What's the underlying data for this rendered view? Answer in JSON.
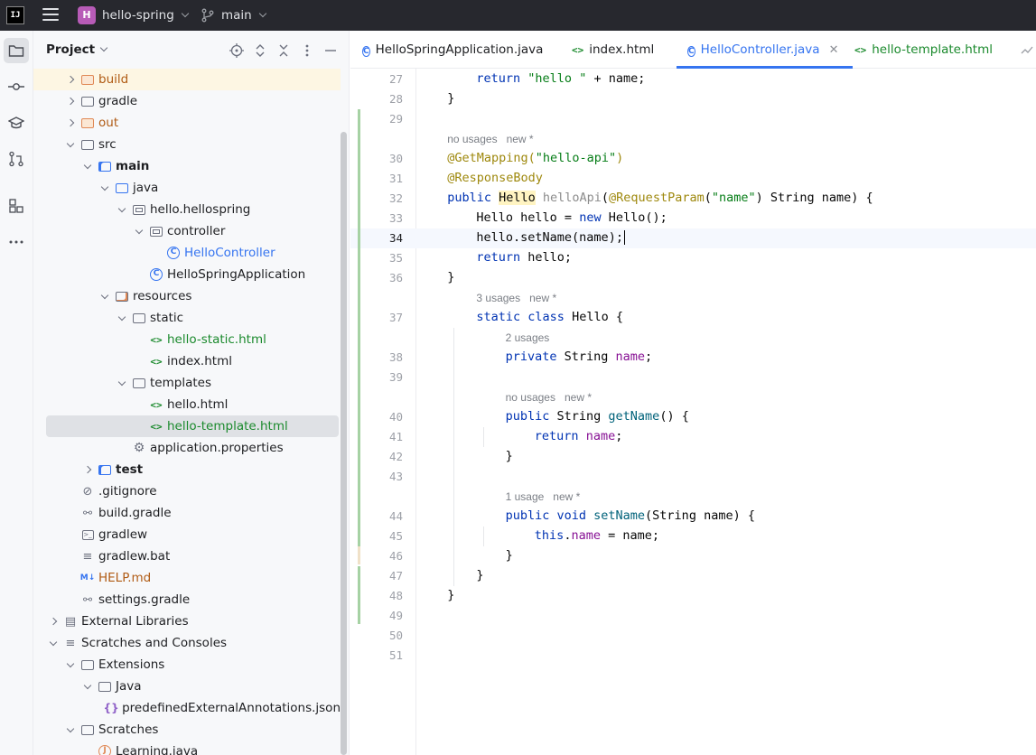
{
  "titlebar": {
    "logo_text": "IJ",
    "project_badge": "H",
    "project_name": "hello-spring",
    "branch": "main"
  },
  "toolstrip": {
    "buttons": [
      "folder-icon",
      "commit-icon",
      "learn-icon",
      "pull-request-icon",
      "structure-icon",
      "more-icon"
    ]
  },
  "project_panel": {
    "title": "Project",
    "tree": [
      {
        "label": "build",
        "depth": 1,
        "arrow": "right",
        "icon": "folder-orange",
        "style": "orange",
        "highlight": true
      },
      {
        "label": "gradle",
        "depth": 1,
        "arrow": "right",
        "icon": "folder"
      },
      {
        "label": "out",
        "depth": 1,
        "arrow": "right",
        "icon": "folder-orange",
        "style": "orange"
      },
      {
        "label": "src",
        "depth": 1,
        "arrow": "down",
        "icon": "folder"
      },
      {
        "label": "main",
        "depth": 2,
        "arrow": "down",
        "icon": "folder-module",
        "style": "bold"
      },
      {
        "label": "java",
        "depth": 3,
        "arrow": "down",
        "icon": "folder-blue"
      },
      {
        "label": "hello.hellospring",
        "depth": 4,
        "arrow": "down",
        "icon": "package"
      },
      {
        "label": "controller",
        "depth": 5,
        "arrow": "down",
        "icon": "package"
      },
      {
        "label": "HelloController",
        "depth": 6,
        "arrow": "none",
        "icon": "java-class",
        "style": "blue"
      },
      {
        "label": "HelloSpringApplication",
        "depth": 5,
        "arrow": "none",
        "icon": "java-class"
      },
      {
        "label": "resources",
        "depth": 3,
        "arrow": "down",
        "icon": "folder-resources"
      },
      {
        "label": "static",
        "depth": 4,
        "arrow": "down",
        "icon": "folder"
      },
      {
        "label": "hello-static.html",
        "depth": 5,
        "arrow": "none",
        "icon": "html",
        "style": "green"
      },
      {
        "label": "index.html",
        "depth": 5,
        "arrow": "none",
        "icon": "html"
      },
      {
        "label": "templates",
        "depth": 4,
        "arrow": "down",
        "icon": "folder"
      },
      {
        "label": "hello.html",
        "depth": 5,
        "arrow": "none",
        "icon": "html"
      },
      {
        "label": "hello-template.html",
        "depth": 5,
        "arrow": "none",
        "icon": "html",
        "style": "green",
        "selected": true
      },
      {
        "label": "application.properties",
        "depth": 4,
        "arrow": "none",
        "icon": "settings"
      },
      {
        "label": "test",
        "depth": 2,
        "arrow": "right",
        "icon": "folder-module",
        "style": "bold"
      },
      {
        "label": ".gitignore",
        "depth": 1,
        "arrow": "none",
        "icon": "ignore"
      },
      {
        "label": "build.gradle",
        "depth": 1,
        "arrow": "none",
        "icon": "gradle"
      },
      {
        "label": "gradlew",
        "depth": 1,
        "arrow": "none",
        "icon": "terminal"
      },
      {
        "label": "gradlew.bat",
        "depth": 1,
        "arrow": "none",
        "icon": "text"
      },
      {
        "label": "HELP.md",
        "depth": 1,
        "arrow": "none",
        "icon": "markdown",
        "style": "orange"
      },
      {
        "label": "settings.gradle",
        "depth": 1,
        "arrow": "none",
        "icon": "gradle"
      },
      {
        "label": "External Libraries",
        "depth": 0,
        "arrow": "right",
        "icon": "library"
      },
      {
        "label": "Scratches and Consoles",
        "depth": 0,
        "arrow": "down",
        "icon": "scratches"
      },
      {
        "label": "Extensions",
        "depth": 1,
        "arrow": "down",
        "icon": "folder"
      },
      {
        "label": "Java",
        "depth": 2,
        "arrow": "down",
        "icon": "folder"
      },
      {
        "label": "predefinedExternalAnnotations.json",
        "depth": 3,
        "arrow": "none",
        "icon": "json"
      },
      {
        "label": "Scratches",
        "depth": 1,
        "arrow": "down",
        "icon": "folder"
      },
      {
        "label": "Learning.java",
        "depth": 2,
        "arrow": "none",
        "icon": "java-scratch"
      }
    ]
  },
  "tabs": [
    {
      "label": "HelloSpringApplication.java",
      "icon": "java-class",
      "active": false
    },
    {
      "label": "index.html",
      "icon": "html",
      "active": false
    },
    {
      "label": "HelloController.java",
      "icon": "java-class",
      "active": true,
      "closable": true
    },
    {
      "label": "hello-template.html",
      "icon": "html",
      "active": false,
      "style": "green"
    }
  ],
  "editor": {
    "current_line": 34,
    "lines": [
      {
        "n": "27",
        "indent": 2,
        "tokens": [
          [
            "kw",
            "return "
          ],
          [
            "str",
            "\"hello \""
          ],
          [
            "",
            " + name;"
          ]
        ]
      },
      {
        "n": "28",
        "indent": 1,
        "tokens": [
          [
            "",
            "}"
          ]
        ]
      },
      {
        "n": "29",
        "indent": 0,
        "tokens": []
      },
      {
        "hint": "no usages   new *",
        "indent": 1
      },
      {
        "n": "30",
        "indent": 1,
        "tokens": [
          [
            "ann",
            "@GetMapping("
          ],
          [
            "str",
            "\"hello-api\""
          ],
          [
            "ann",
            ")"
          ]
        ]
      },
      {
        "n": "31",
        "indent": 1,
        "tokens": [
          [
            "ann",
            "@ResponseBody"
          ]
        ]
      },
      {
        "n": "32",
        "indent": 1,
        "tokens": [
          [
            "kw",
            "public "
          ],
          [
            "hlcls",
            "Hello"
          ],
          [
            "",
            " "
          ],
          [
            "unused",
            "helloApi"
          ],
          [
            "",
            "("
          ],
          [
            "ann",
            "@RequestParam"
          ],
          [
            "",
            "("
          ],
          [
            "str",
            "\"name\""
          ],
          [
            "",
            ") String name) {"
          ]
        ]
      },
      {
        "n": "33",
        "indent": 2,
        "tokens": [
          [
            "",
            "Hello hello = "
          ],
          [
            "kw",
            "new "
          ],
          [
            "",
            "Hello();"
          ]
        ]
      },
      {
        "n": "34",
        "indent": 2,
        "tokens": [
          [
            "",
            "hello.setName(name);"
          ]
        ],
        "caret": true
      },
      {
        "n": "35",
        "indent": 2,
        "tokens": [
          [
            "kw",
            "return "
          ],
          [
            "",
            "hello;"
          ]
        ]
      },
      {
        "n": "36",
        "indent": 1,
        "tokens": [
          [
            "",
            "}"
          ]
        ]
      },
      {
        "hint": "3 usages   new *",
        "indent": 2
      },
      {
        "n": "37",
        "indent": 2,
        "tokens": [
          [
            "kw",
            "static class "
          ],
          [
            "",
            "Hello {"
          ]
        ]
      },
      {
        "hint": "2 usages",
        "indent": 3
      },
      {
        "n": "38",
        "indent": 3,
        "tokens": [
          [
            "kw",
            "private "
          ],
          [
            "",
            "String "
          ],
          [
            "fld",
            "name"
          ],
          [
            "",
            ";"
          ]
        ]
      },
      {
        "n": "39",
        "indent": 0,
        "tokens": []
      },
      {
        "hint": "no usages   new *",
        "indent": 3
      },
      {
        "n": "40",
        "indent": 3,
        "tokens": [
          [
            "kw",
            "public "
          ],
          [
            "",
            "String "
          ],
          [
            "fn",
            "getName"
          ],
          [
            "",
            "() {"
          ]
        ]
      },
      {
        "n": "41",
        "indent": 4,
        "tokens": [
          [
            "kw",
            "return "
          ],
          [
            "fld",
            "name"
          ],
          [
            "",
            ";"
          ]
        ]
      },
      {
        "n": "42",
        "indent": 3,
        "tokens": [
          [
            "",
            "}"
          ]
        ]
      },
      {
        "n": "43",
        "indent": 0,
        "tokens": []
      },
      {
        "hint": "1 usage   new *",
        "indent": 3
      },
      {
        "n": "44",
        "indent": 3,
        "tokens": [
          [
            "kw",
            "public void "
          ],
          [
            "fn",
            "setName"
          ],
          [
            "",
            "(String name) {"
          ]
        ]
      },
      {
        "n": "45",
        "indent": 4,
        "tokens": [
          [
            "kw",
            "this"
          ],
          [
            "",
            "."
          ],
          [
            "fld",
            "name"
          ],
          [
            "",
            " = name;"
          ]
        ]
      },
      {
        "n": "46",
        "indent": 3,
        "tokens": [
          [
            "",
            "}"
          ]
        ]
      },
      {
        "n": "47",
        "indent": 2,
        "tokens": [
          [
            "",
            "}"
          ]
        ]
      },
      {
        "n": "48",
        "indent": 1,
        "tokens": [
          [
            "",
            "}"
          ]
        ]
      },
      {
        "n": "49",
        "indent": 0,
        "tokens": []
      },
      {
        "n": "50",
        "indent": 0,
        "tokens": []
      },
      {
        "n": "51",
        "indent": 0,
        "tokens": []
      }
    ]
  }
}
